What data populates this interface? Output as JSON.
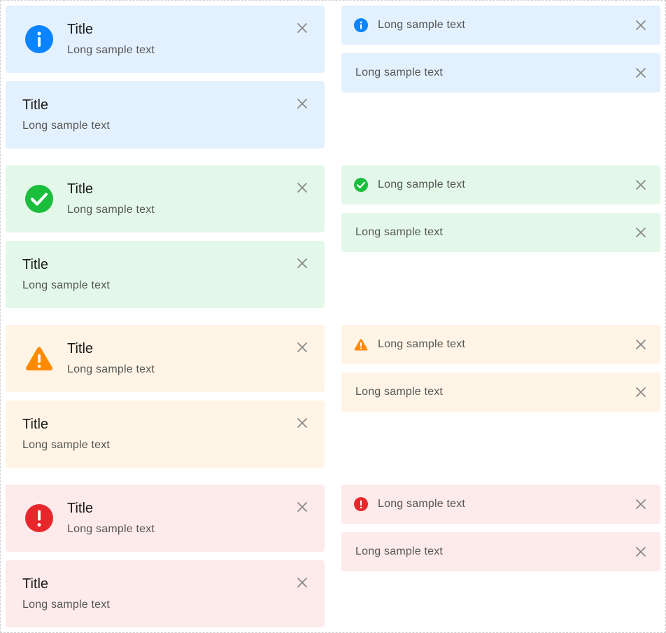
{
  "colors": {
    "info": "#0a84ff",
    "success": "#1bbd3c",
    "warning": "#ff8a00",
    "error": "#e8272d"
  },
  "alerts": {
    "info": {
      "icon_big": {
        "title": "Title",
        "text": "Long sample text",
        "icon": "info-icon"
      },
      "plain_big": {
        "title": "Title",
        "text": "Long sample text"
      },
      "icon_small": {
        "text": "Long sample text",
        "icon": "info-icon"
      },
      "plain_small": {
        "text": "Long sample text"
      }
    },
    "success": {
      "icon_big": {
        "title": "Title",
        "text": "Long sample text",
        "icon": "check-circle-icon"
      },
      "plain_big": {
        "title": "Title",
        "text": "Long sample text"
      },
      "icon_small": {
        "text": "Long sample text",
        "icon": "check-circle-icon"
      },
      "plain_small": {
        "text": "Long sample text"
      }
    },
    "warning": {
      "icon_big": {
        "title": "Title",
        "text": "Long sample text",
        "icon": "warning-triangle-icon"
      },
      "plain_big": {
        "title": "Title",
        "text": "Long sample text"
      },
      "icon_small": {
        "text": "Long sample text",
        "icon": "warning-triangle-icon"
      },
      "plain_small": {
        "text": "Long sample text"
      }
    },
    "error": {
      "icon_big": {
        "title": "Title",
        "text": "Long sample text",
        "icon": "error-circle-icon"
      },
      "plain_big": {
        "title": "Title",
        "text": "Long sample text"
      },
      "icon_small": {
        "text": "Long sample text",
        "icon": "error-circle-icon"
      },
      "plain_small": {
        "text": "Long sample text"
      }
    }
  }
}
